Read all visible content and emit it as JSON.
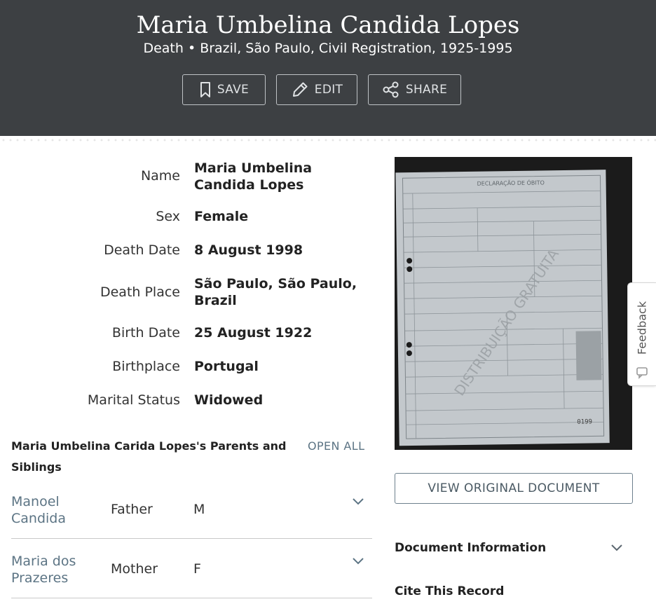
{
  "header": {
    "title": "Maria Umbelina Candida Lopes",
    "subtitle": "Death • Brazil, São Paulo, Civil Registration, 1925-1995",
    "buttons": {
      "save": "SAVE",
      "edit": "EDIT",
      "share": "SHARE"
    },
    "background": "#3d4043"
  },
  "fields": [
    {
      "label": "Name",
      "value": "Maria Umbelina Candida Lopes"
    },
    {
      "label": "Sex",
      "value": "Female"
    },
    {
      "label": "Death Date",
      "value": "8 August 1998"
    },
    {
      "label": "Death Place",
      "value": "São Paulo, São Paulo, Brazil"
    },
    {
      "label": "Birth Date",
      "value": "25 August 1922"
    },
    {
      "label": "Birthplace",
      "value": "Portugal"
    },
    {
      "label": "Marital Status",
      "value": "Widowed"
    }
  ],
  "parents": {
    "heading": "Maria Umbelina Carida Lopes's Parents and Siblings",
    "open_all": "OPEN ALL",
    "rows": [
      {
        "name": "Manoel Candida",
        "relation": "Father",
        "sex": "M"
      },
      {
        "name": "Maria dos Prazeres",
        "relation": "Mother",
        "sex": "F"
      }
    ],
    "link_color": "#5c7484"
  },
  "document": {
    "image_watermark": "DISTRIBUIÇÃO GRATUITA",
    "image_header": "DECLARAÇÃO DE ÓBITO",
    "image_number": "0199",
    "view_button": "VIEW ORIGINAL DOCUMENT",
    "info_heading": "Document Information",
    "cite_heading": "Cite This Record"
  },
  "feedback": {
    "label": "Feedback"
  },
  "icons": [
    "bookmark-icon",
    "pencil-icon",
    "share-icon",
    "chevron-down-icon",
    "feedback-icon"
  ]
}
